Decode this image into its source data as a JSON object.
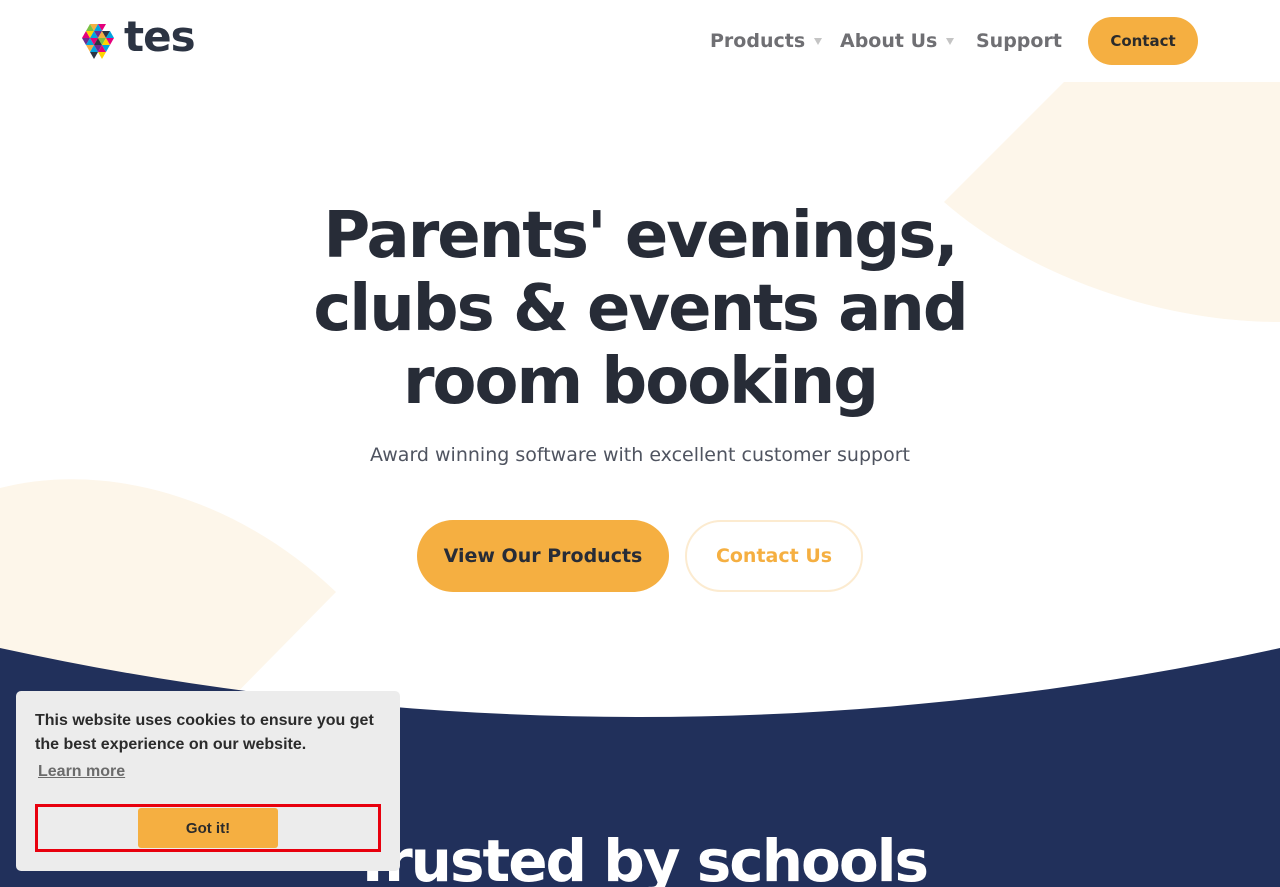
{
  "colors": {
    "accent": "#f5af41",
    "navy": "#21305b",
    "cream": "#fdf6ea",
    "text_dark": "#272c37",
    "nav_text": "#6f6f73",
    "cookie_bg": "#ececec",
    "highlight_frame": "#e8000e"
  },
  "header": {
    "logo_text": "tes",
    "logo_icon": "tes-triangle-logo-icon",
    "nav": {
      "products": "Products",
      "about": "About Us",
      "support": "Support",
      "contact": "Contact"
    },
    "dropdown_icon": "caret-down-icon"
  },
  "hero": {
    "title_lines": [
      "Parents' evenings,",
      "clubs & events and",
      "room booking"
    ],
    "subtitle": "Award winning software with excellent customer support",
    "primary_button": "View Our Products",
    "secondary_button": "Contact Us"
  },
  "band": {
    "heading": "Trusted by schools"
  },
  "cookie_banner": {
    "message": "This website uses cookies to ensure you get the best experience on our website.",
    "learn_more": "Learn more",
    "accept_button": "Got it!"
  }
}
